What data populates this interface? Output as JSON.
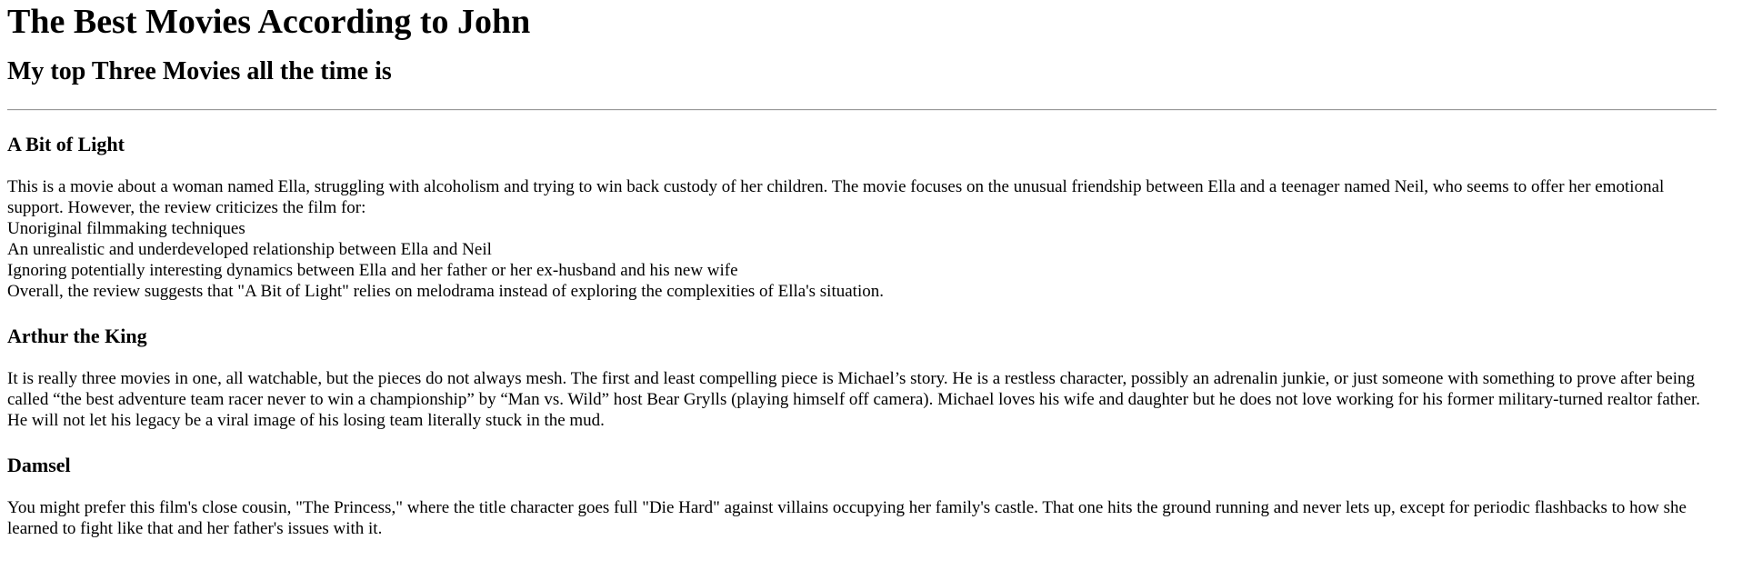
{
  "page": {
    "title": "The Best Movies According to John",
    "subtitle": "My top Three Movies all the time is"
  },
  "movies": [
    {
      "title": "A Bit of Light",
      "intro": "This is a movie about a woman named Ella, struggling with alcoholism and trying to win back custody of her children. The movie focuses on the unusual friendship between Ella and a teenager named Neil, who seems to offer her emotional support. However, the review criticizes the film for:",
      "points": [
        "Unoriginal filmmaking techniques",
        "An unrealistic and underdeveloped relationship between Ella and Neil",
        "Ignoring potentially interesting dynamics between Ella and her father or her ex-husband and his new wife"
      ],
      "conclusion": "Overall, the review suggests that \"A Bit of Light\" relies on melodrama instead of exploring the complexities of Ella's situation."
    },
    {
      "title": "Arthur the King",
      "text": "It is really three movies in one, all watchable, but the pieces do not always mesh. The first and least compelling piece is Michael’s story. He is a restless character, possibly an adrenalin junkie, or just someone with something to prove after being called “the best adventure team racer never to win a championship” by “Man vs. Wild” host Bear Grylls (playing himself off camera). Michael loves his wife and daughter but he does not love working for his former military-turned realtor father. He will not let his legacy be a viral image of his losing team literally stuck in the mud."
    },
    {
      "title": "Damsel",
      "text": "You might prefer this film's close cousin, \"The Princess,\" where the title character goes full \"Die Hard\" against villains occupying her family's castle. That one hits the ground running and never lets up, except for periodic flashbacks to how she learned to fight like that and her father's issues with it."
    }
  ]
}
